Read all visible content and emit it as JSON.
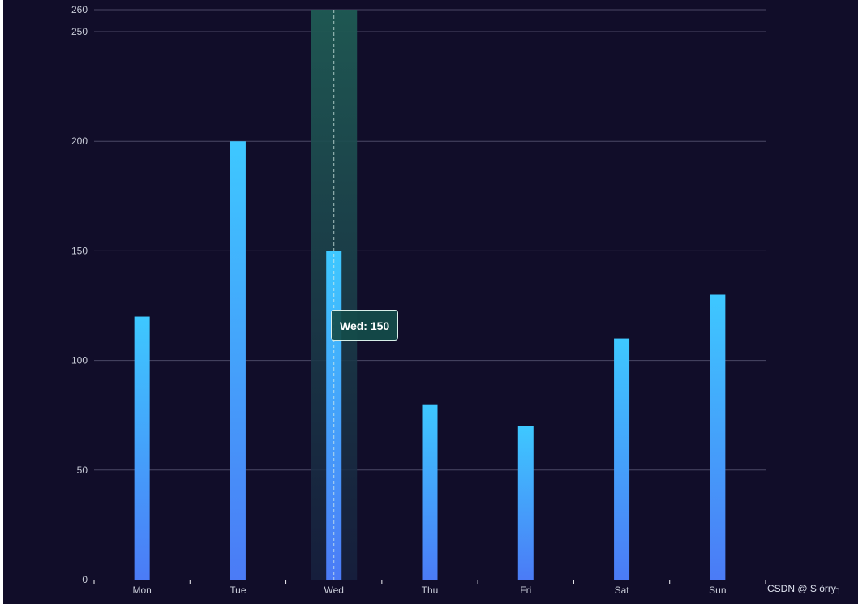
{
  "chart_data": {
    "type": "bar",
    "categories": [
      "Mon",
      "Tue",
      "Wed",
      "Thu",
      "Fri",
      "Sat",
      "Sun"
    ],
    "values": [
      120,
      200,
      150,
      80,
      70,
      110,
      130
    ],
    "ylim": [
      0,
      260
    ],
    "yticks": [
      0,
      50,
      100,
      150,
      200,
      250,
      260
    ],
    "ytick_labels": [
      "0",
      "50",
      "100",
      "150",
      "200",
      "250",
      "260"
    ],
    "grid": true,
    "highlighted_category": "Wed",
    "bar_gradient": [
      "#3ec8ff",
      "#4b7bf6"
    ],
    "background_color": "#110d29",
    "highlight_color": "#1f5b54"
  },
  "tooltip": {
    "text": "Wed: 150"
  },
  "watermark": {
    "text": "CSDN @ S òrry╮"
  }
}
